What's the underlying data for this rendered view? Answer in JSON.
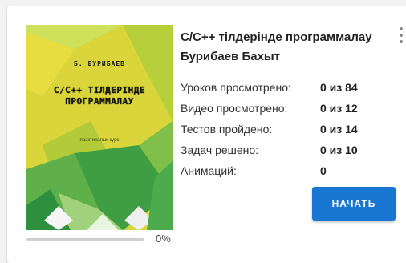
{
  "course": {
    "title": "С/С++ тілдерінде программалау Бурибаев Бахыт",
    "cover": {
      "author": "Б. БУРИБАЕВ",
      "title": "С/С++ ТІЛДЕРІНДЕ ПРОГРАММАЛАУ",
      "subtitle": "практикалық курс"
    },
    "stats": [
      {
        "label": "Уроков просмотрено:",
        "value": "0 из 84"
      },
      {
        "label": "Видео просмотрено:",
        "value": "0 из 12"
      },
      {
        "label": "Тестов пройдено:",
        "value": "0 из 14"
      },
      {
        "label": "Задач решено:",
        "value": "0 из 10"
      },
      {
        "label": "Анимаций:",
        "value": "0"
      }
    ],
    "start_button": "НАЧАТЬ",
    "progress": {
      "fraction": 0,
      "text": "0%"
    }
  },
  "colors": {
    "accent": "#1976d2",
    "cover_yellow": "#d6d236",
    "cover_green": "#3fa34a"
  },
  "icons": {
    "menu": "more-vert-icon"
  }
}
